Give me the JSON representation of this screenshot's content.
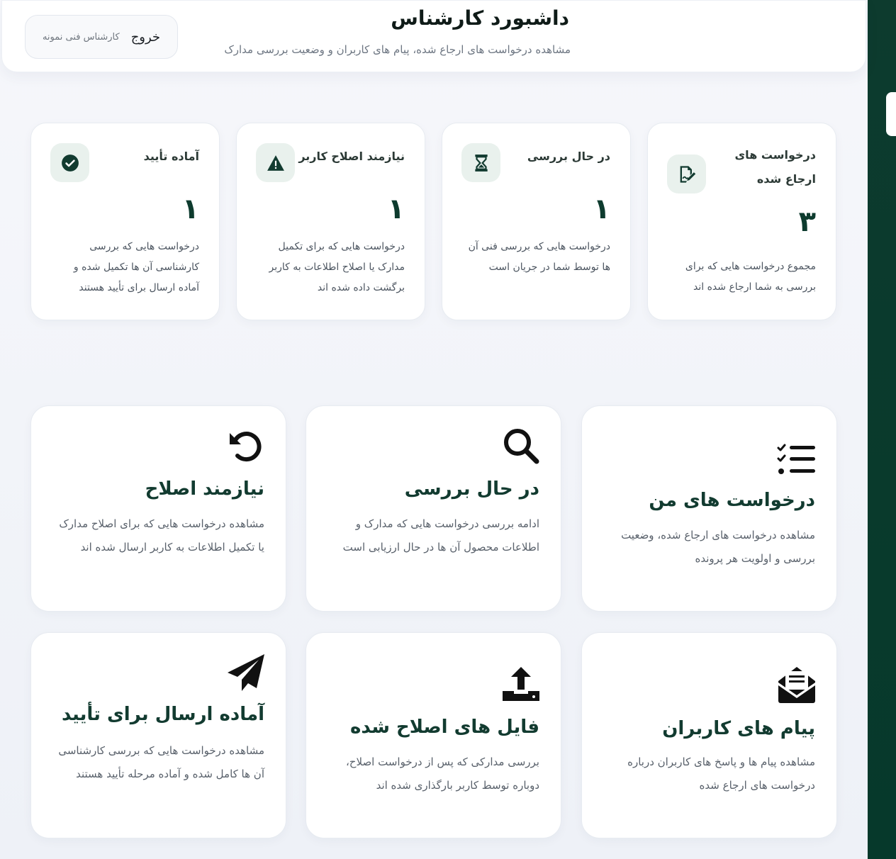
{
  "header": {
    "title": "داشبورد کارشناس",
    "subtitle": "مشاهده درخواست های ارجاع شده، پیام های کاربران و وضعیت بررسی مدارک",
    "logout_label": "خروج",
    "user_name": "کارشناس فنی نمونه"
  },
  "stats": [
    {
      "title": "درخواست های ارجاع شده",
      "value": "۳",
      "description": "مجموع درخواست هایی که برای بررسی به شما ارجاع شده اند",
      "icon": "file-signature-icon"
    },
    {
      "title": "در حال بررسی",
      "value": "۱",
      "description": "درخواست هایی که بررسی فنی آن ها توسط شما در جریان است",
      "icon": "hourglass-icon"
    },
    {
      "title": "نیازمند اصلاح کاربر",
      "value": "۱",
      "description": "درخواست هایی که برای تکمیل مدارک یا اصلاح اطلاعات به کاربر برگشت داده شده اند",
      "icon": "warning-icon"
    },
    {
      "title": "آماده تأیید",
      "value": "۱",
      "description": "درخواست هایی که بررسی کارشناسی آن ها تکمیل شده و آماده ارسال برای تأیید هستند",
      "icon": "check-circle-icon"
    }
  ],
  "features": [
    {
      "title": "درخواست های من",
      "description": "مشاهده درخواست های ارجاع شده، وضعیت بررسی و اولویت هر پرونده",
      "icon": "task-list-icon"
    },
    {
      "title": "در حال بررسی",
      "description": "ادامه بررسی درخواست هایی که مدارک و اطلاعات محصول آن ها در حال ارزیابی است",
      "icon": "search-icon"
    },
    {
      "title": "نیازمند اصلاح",
      "description": "مشاهده درخواست هایی که برای اصلاح مدارک یا تکمیل اطلاعات به کاربر ارسال شده اند",
      "icon": "undo-icon"
    },
    {
      "title": "پیام های کاربران",
      "description": "مشاهده پیام ها و پاسخ های کاربران درباره درخواست های ارجاع شده",
      "icon": "envelope-open-icon"
    },
    {
      "title": "فایل های اصلاح شده",
      "description": "بررسی مدارکی که پس از درخواست اصلاح، دوباره توسط کاربر بارگذاری شده اند",
      "icon": "upload-icon"
    },
    {
      "title": "آماده ارسال برای تأیید",
      "description": "مشاهده درخواست هایی که بررسی کارشناسی آن ها کامل شده و آماده مرحله تأیید هستند",
      "icon": "paper-plane-icon"
    }
  ],
  "colors": {
    "accent": "#0d3b2e",
    "icon_bg": "#e9f1ed",
    "text_muted": "#59616b"
  }
}
